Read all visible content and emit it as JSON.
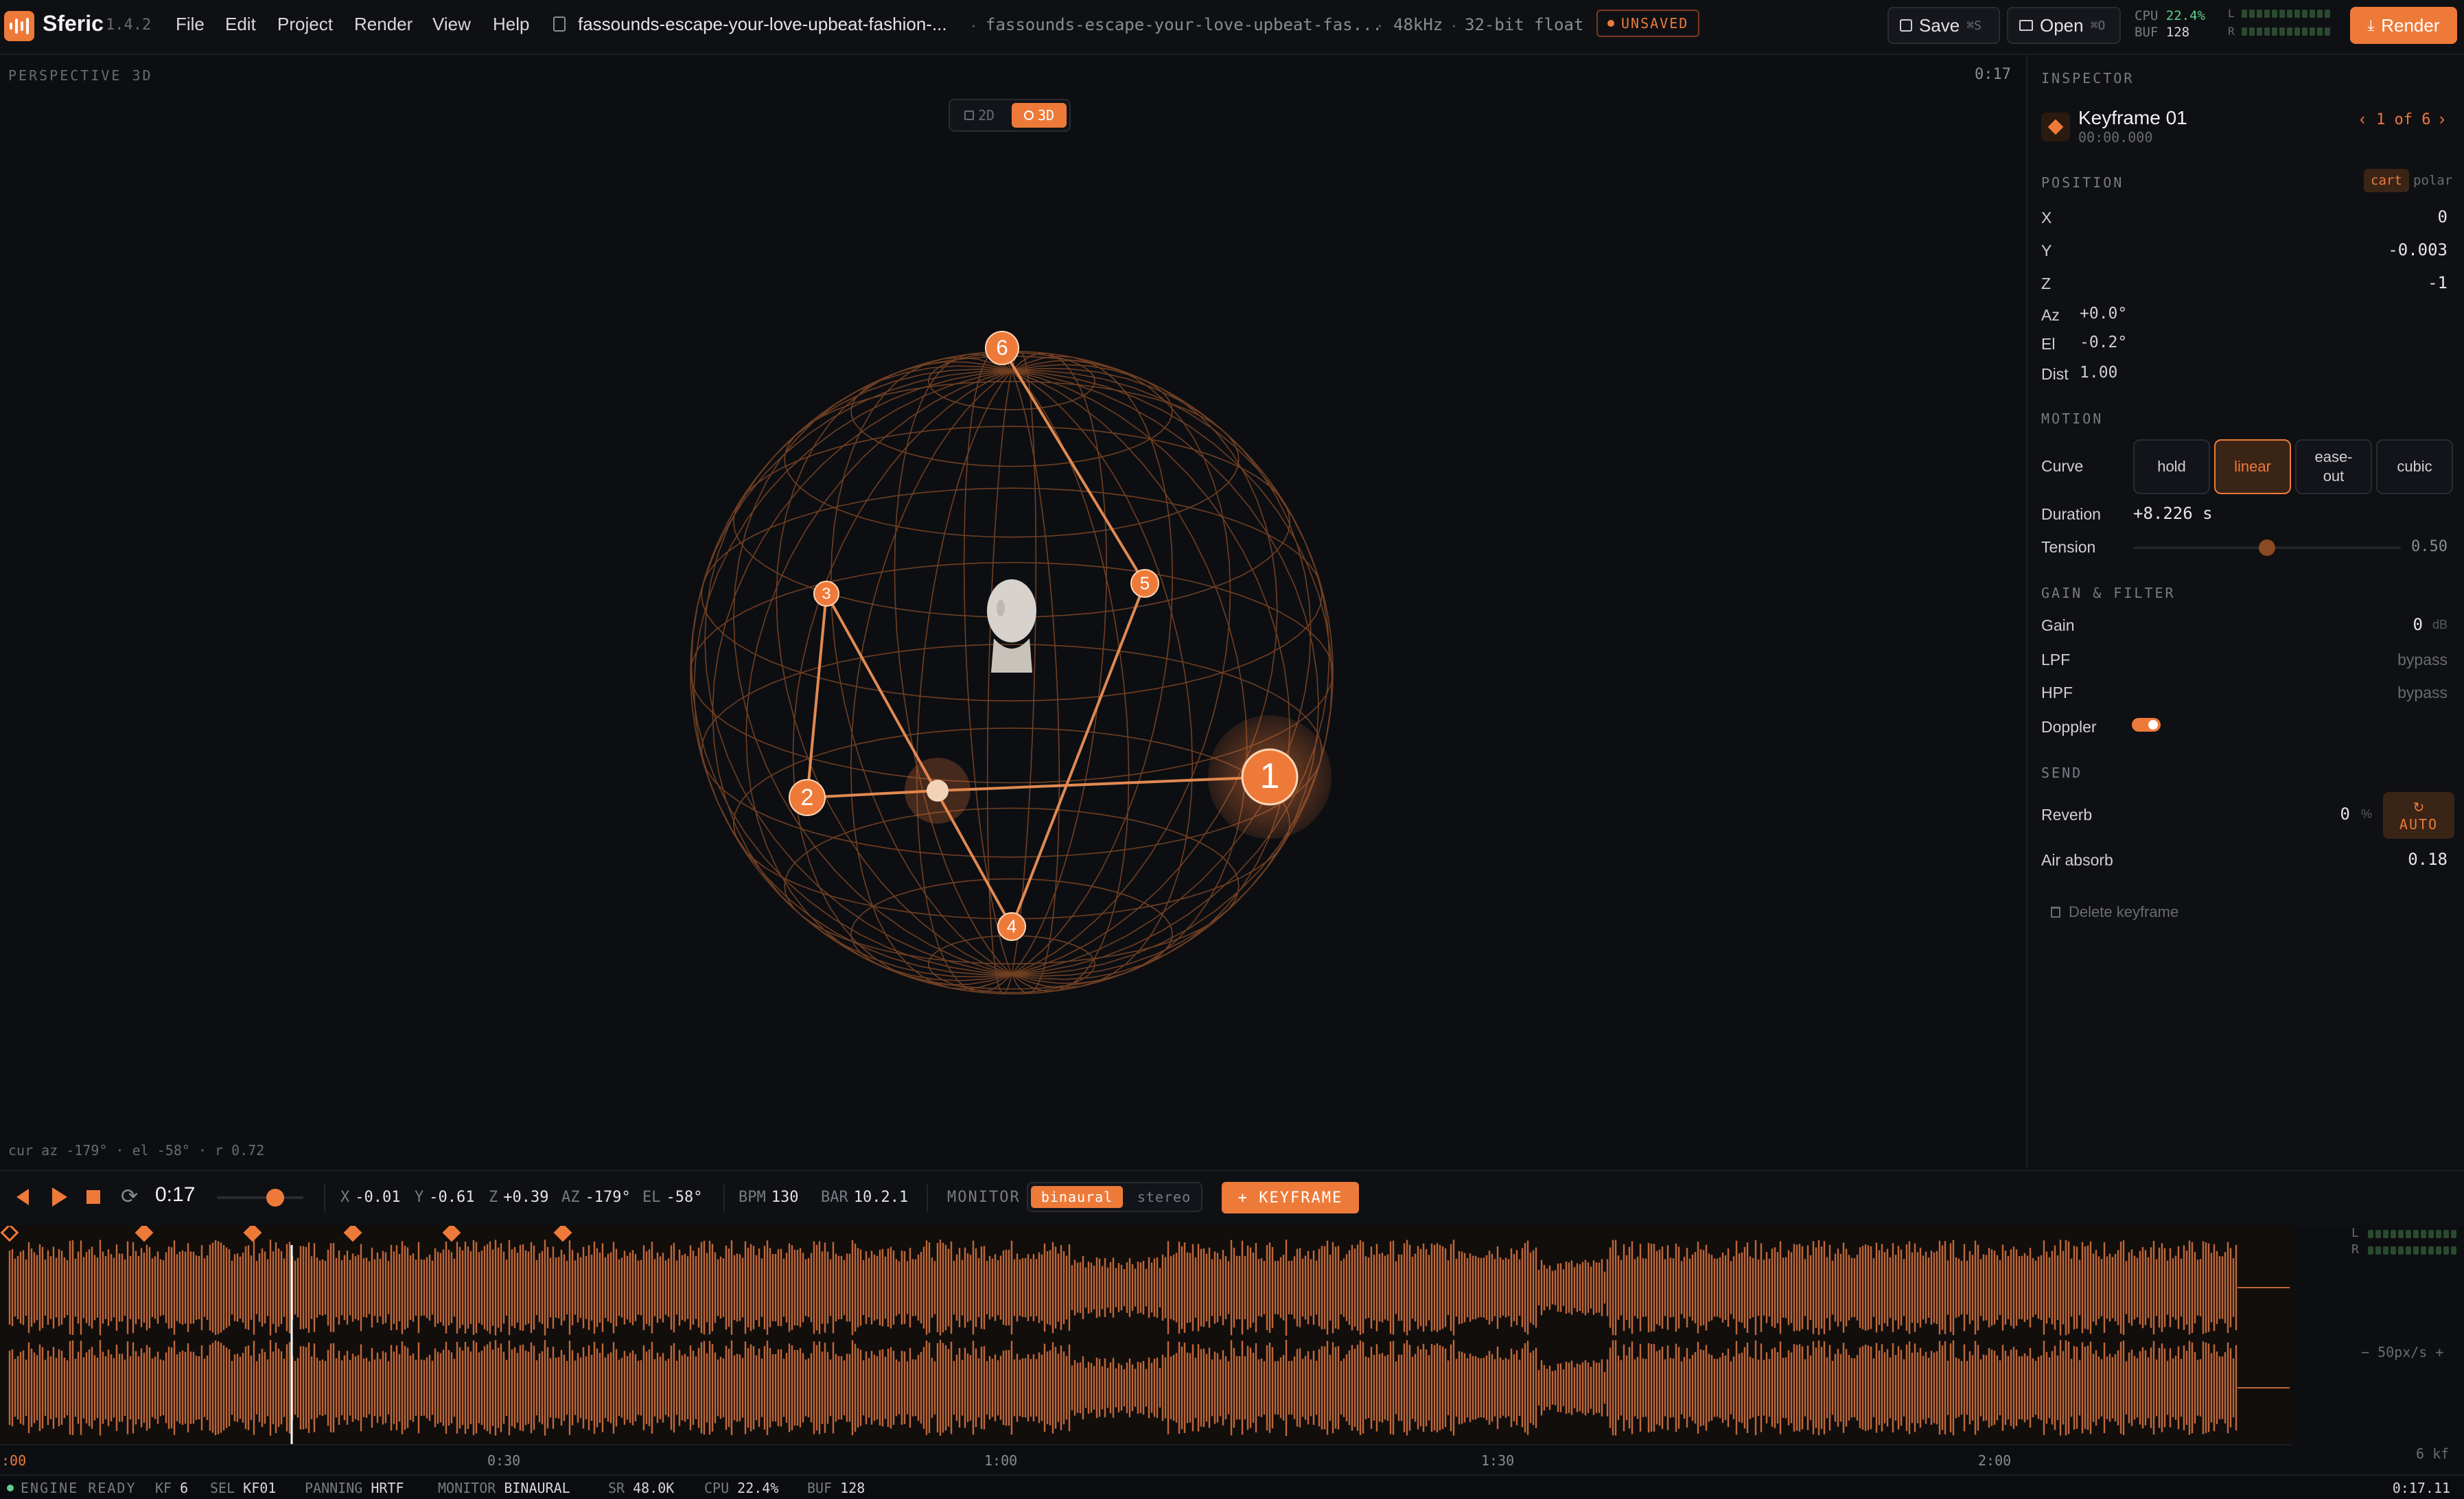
{
  "app": {
    "name": "Sferic",
    "version": "1.4.2"
  },
  "menu": [
    "File",
    "Edit",
    "Project",
    "Render",
    "View",
    "Help"
  ],
  "file": {
    "name": "fassounds-escape-your-love-upbeat-fashion-...",
    "name2": "fassounds-escape-your-love-upbeat-fas...",
    "rate": "48kHz",
    "depth": "32-bit float",
    "status": "UNSAVED"
  },
  "toolbar": {
    "save_label": "Save",
    "save_kbd": "⌘S",
    "open_label": "Open",
    "open_kbd": "⌘O",
    "render_label": "Render",
    "cpu_label": "CPU",
    "cpu_value": "22.4%",
    "buf_label": "BUF",
    "buf_value": "128",
    "meter_l": "L",
    "meter_r": "R"
  },
  "viewport": {
    "mode_label": "PERSPECTIVE 3D",
    "time": "0:17",
    "toggle_2d": "2D",
    "toggle_3d": "3D",
    "cursor_readout": "cur az -179° · el -58° · r 0.72",
    "keyframes": [
      "1",
      "2",
      "3",
      "4",
      "5",
      "6"
    ]
  },
  "inspector": {
    "section": "INSPECTOR",
    "keyframe_title": "Keyframe 01",
    "keyframe_time": "00:00.000",
    "pager": "1 of 6",
    "position_label": "POSITION",
    "coord_cart": "cart",
    "coord_polar": "polar",
    "x_label": "X",
    "x_value": "0",
    "y_label": "Y",
    "y_value": "-0.003",
    "z_label": "Z",
    "z_value": "-1",
    "az_label": "Az",
    "az_value": "+0.0°",
    "el_label": "El",
    "el_value": "-0.2°",
    "dist_label": "Dist",
    "dist_value": "1.00",
    "motion_label": "MOTION",
    "curve_label": "Curve",
    "curves": [
      "hold",
      "linear",
      "ease-\nout",
      "cubic"
    ],
    "duration_label": "Duration",
    "duration_value": "+8.226 s",
    "tension_label": "Tension",
    "tension_value": "0.50",
    "tension_level": 0.5,
    "gain_section": "GAIN & FILTER",
    "gain_label": "Gain",
    "gain_value": "0",
    "gain_unit": "dB",
    "lpf_label": "LPF",
    "lpf_value": "bypass",
    "hpf_label": "HPF",
    "hpf_value": "bypass",
    "doppler_label": "Doppler",
    "send_section": "SEND",
    "reverb_label": "Reverb",
    "reverb_value": "0",
    "reverb_unit": "%",
    "reverb_auto": "AUTO",
    "air_label": "Air absorb",
    "air_value": "0.18",
    "delete_label": "Delete keyframe"
  },
  "transport": {
    "time": "0:17",
    "x_k": "X",
    "x_v": "-0.01",
    "y_k": "Y",
    "y_v": "-0.61",
    "z_k": "Z",
    "z_v": "+0.39",
    "az_k": "AZ",
    "az_v": "-179°",
    "el_k": "EL",
    "el_v": "-58°",
    "bpm_k": "BPM",
    "bpm_v": "130",
    "bar_k": "BAR",
    "bar_v": "10.2.1",
    "monitor_k": "MONITOR",
    "binaural": "binaural",
    "stereo": "stereo",
    "keyframe_btn": "+ KEYFRAME"
  },
  "wave": {
    "l": "L",
    "r": "R",
    "zoom": "50px/s",
    "kf_count": "6 kf"
  },
  "timeline": {
    "ticks": [
      ":00",
      "0:30",
      "1:00",
      "1:30",
      "2:00"
    ]
  },
  "status": {
    "engine": "ENGINE READY",
    "kf_k": "KF",
    "kf_v": "6",
    "sel_k": "SEL",
    "sel_v": "KF01",
    "pan_k": "PANNING",
    "pan_v": "HRTF",
    "mon_k": "MONITOR",
    "mon_v": "BINAURAL",
    "sr_k": "SR",
    "sr_v": "48.0K",
    "cpu_k": "CPU",
    "cpu_v": "22.4%",
    "buf_k": "BUF",
    "buf_v": "128",
    "clock": "0:17.11"
  },
  "colors": {
    "accent": "#ee7a3a",
    "bg": "#0d0e12",
    "panel": "#0f1014"
  }
}
